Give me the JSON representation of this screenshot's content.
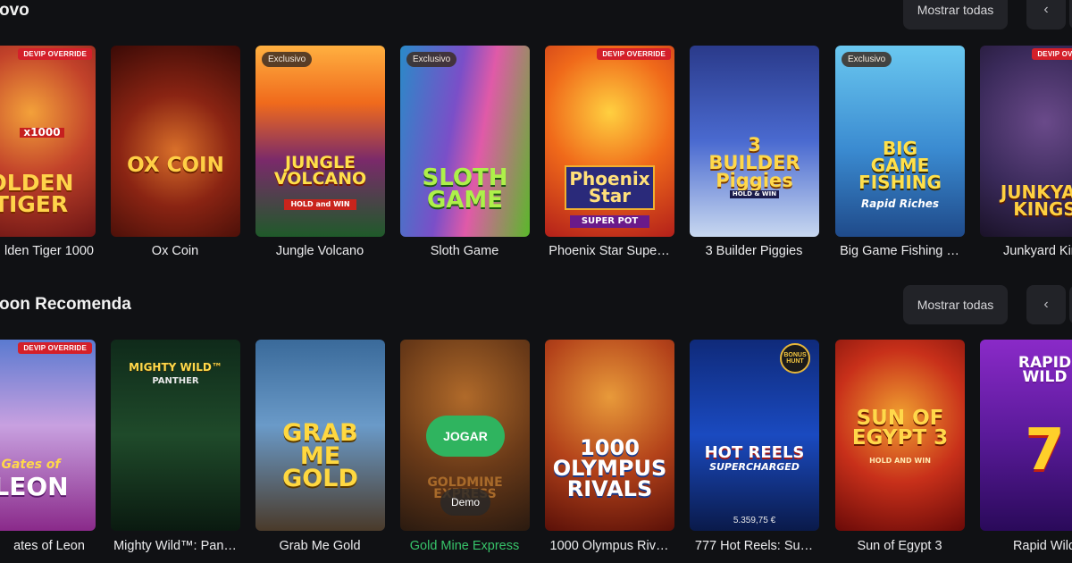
{
  "sections": [
    {
      "title": "ovo",
      "show_all": "Mostrar todas",
      "prev": "‹",
      "games": [
        {
          "name": "lden Tiger 1000",
          "badge_devip": "DEVIP OVERRIDE",
          "logo": "OLDEN TIGER",
          "sub": "x1000"
        },
        {
          "name": "Ox Coin",
          "logo": "OX COIN"
        },
        {
          "name": "Jungle Volcano",
          "badge_ex": "Exclusivo",
          "logo": "JUNGLE VOLCANO",
          "sub": "HOLD and WIN"
        },
        {
          "name": "Sloth Game",
          "badge_ex": "Exclusivo",
          "logo": "SLOTH GAME"
        },
        {
          "name": "Phoenix Star Supe…",
          "badge_devip": "DEVIP OVERRIDE",
          "logo": "Phoenix Star",
          "sub": "SUPER POT"
        },
        {
          "name": "3 Builder Piggies",
          "logo": "3 BUILDER Piggies",
          "sub": "HOLD & WIN"
        },
        {
          "name": "Big Game Fishing …",
          "badge_ex": "Exclusivo",
          "logo": "BIG GAME FISHING",
          "sub": "Rapid Riches"
        },
        {
          "name": "Junkyard King",
          "badge_devip": "DEVIP OVERRIDE",
          "logo": "JUNKYAR KINGS"
        }
      ]
    },
    {
      "title": "oon Recomenda",
      "show_all": "Mostrar todas",
      "prev": "‹",
      "games": [
        {
          "name": "ates of Leon",
          "badge_devip": "DEVIP OVERRIDE",
          "logo": "LEON",
          "sub": "Gates of"
        },
        {
          "name": "Mighty Wild™: Pan…",
          "logo": "MIGHTY WILD™",
          "sub": "PANTHER"
        },
        {
          "name": "Grab Me Gold",
          "logo": "GRAB ME GOLD"
        },
        {
          "name": "Gold Mine Express",
          "logo": "GOLDMINE EXPRESS",
          "jogar": "JOGAR",
          "demo": "Demo"
        },
        {
          "name": "1000 Olympus Riv…",
          "logo": "1000 OLYMPUS RIVALS"
        },
        {
          "name": "777 Hot Reels: Su…",
          "logo": "HOT REELS",
          "sub": "SUPERCHARGED",
          "price": "5.359,75 €",
          "chip": "BONUS HUNT"
        },
        {
          "name": "Sun of Egypt 3",
          "logo": "SUN OF EGYPT 3",
          "sub": "HOLD AND WIN"
        },
        {
          "name": "Rapid Wild",
          "logo": "RAPID WILD",
          "sub": "7"
        }
      ]
    }
  ],
  "colors": {
    "background": "#101114",
    "button": "#222328",
    "accent_green": "#2fb45f"
  }
}
